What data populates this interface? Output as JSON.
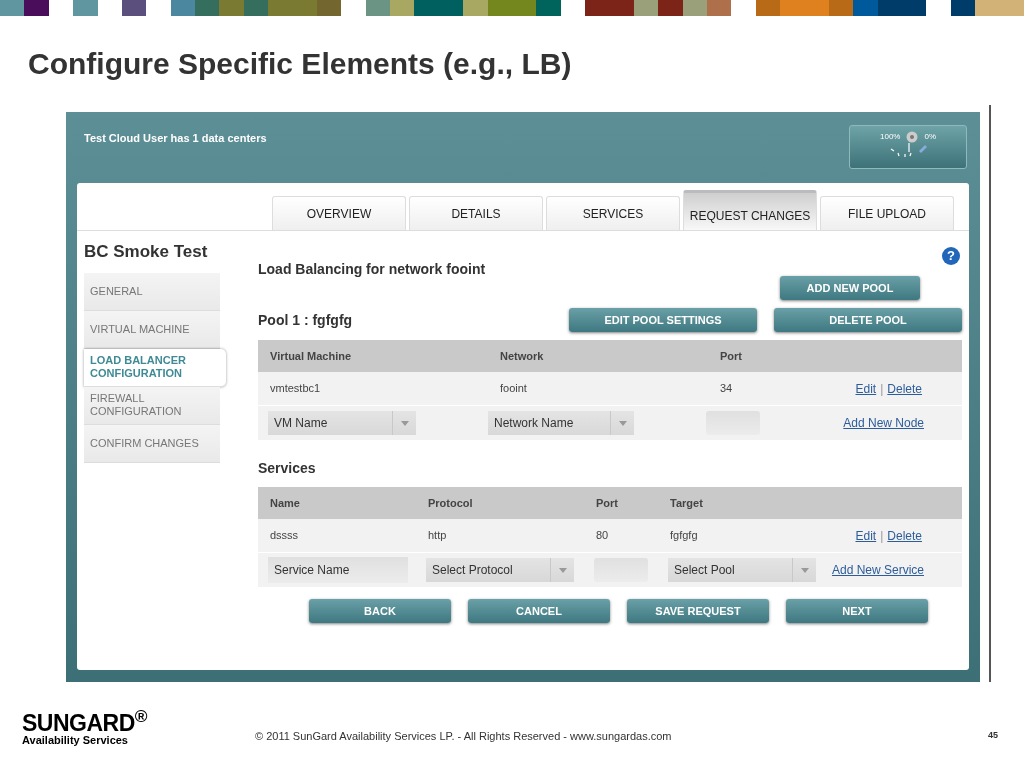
{
  "slide": {
    "title": "Configure Specific Elements (e.g., LB)"
  },
  "app": {
    "header_text": "Test Cloud User has 1 data centers",
    "gauge": {
      "left_label": "100%",
      "right_label": "0%"
    },
    "tabs": [
      {
        "label": "OVERVIEW",
        "selected": false
      },
      {
        "label": "DETAILS",
        "selected": false
      },
      {
        "label": "SERVICES",
        "selected": false
      },
      {
        "label": "REQUEST CHANGES",
        "selected": true
      },
      {
        "label": "FILE UPLOAD",
        "selected": false
      }
    ],
    "page_title": "BC Smoke Test",
    "side_nav": [
      {
        "label": "GENERAL",
        "selected": false
      },
      {
        "label": "VIRTUAL MACHINE",
        "selected": false
      },
      {
        "label": "LOAD BALANCER CONFIGURATION",
        "selected": true
      },
      {
        "label": "FIREWALL CONFIGURATION",
        "selected": false
      },
      {
        "label": "CONFIRM CHANGES",
        "selected": false
      }
    ],
    "help_label": "?",
    "section_title": "Load Balancing for network fooint",
    "add_pool_button": "ADD NEW POOL",
    "pool": {
      "title": "Pool 1 : fgfgfg",
      "buttons": [
        "EDIT POOL SETTINGS",
        "DELETE POOL"
      ],
      "columns": [
        "Virtual Machine",
        "Network",
        "Port"
      ],
      "rows": [
        {
          "cells": [
            "vmtestbc1",
            "fooint",
            "34"
          ],
          "edit": "Edit",
          "separator": "|",
          "delete": "Delete"
        }
      ],
      "new_row": {
        "vm_select": "VM Name",
        "network_select": "Network Name",
        "add_link": "Add New Node"
      }
    },
    "services": {
      "title": "Services",
      "columns": [
        "Name",
        "Protocol",
        "Port",
        "Target"
      ],
      "rows": [
        {
          "cells": [
            "dssss",
            "http",
            "80",
            "fgfgfg"
          ],
          "edit": "Edit",
          "separator": "|",
          "delete": "Delete"
        }
      ],
      "new_row": {
        "name_placeholder": "Service Name",
        "protocol_select": "Select Protocol",
        "pool_select": "Select Pool",
        "add_link": "Add New Service"
      }
    },
    "nav_buttons": [
      "BACK",
      "CANCEL",
      "SAVE REQUEST",
      "NEXT"
    ]
  },
  "footer": {
    "logo_top": "SUNGARD$^{®}$",
    "logo_bottom": "Availability Services",
    "copyright": "© 2011 SunGard Availability Services LP. - All Rights Reserved - www.sungardas.com",
    "page_number": "45"
  }
}
